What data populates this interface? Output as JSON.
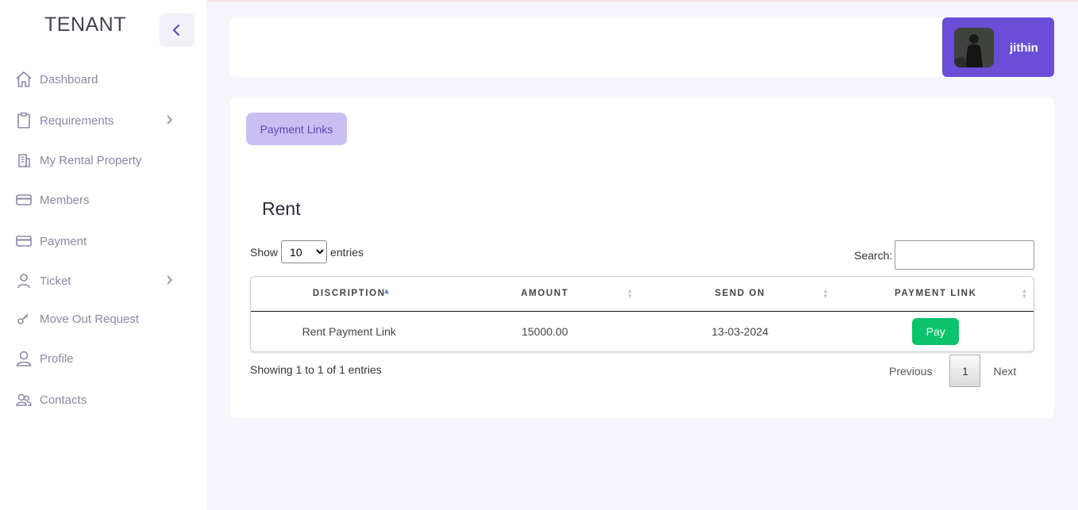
{
  "sidebar": {
    "brand": "TENANT",
    "items": [
      {
        "label": "Dashboard",
        "icon": "home-icon"
      },
      {
        "label": "Requirements",
        "icon": "clipboard-icon",
        "has_submenu": true
      },
      {
        "label": "My Rental Property",
        "icon": "building-icon"
      },
      {
        "label": "Members",
        "icon": "card-icon"
      },
      {
        "label": "Payment",
        "icon": "card-icon"
      },
      {
        "label": "Ticket",
        "icon": "person-icon",
        "has_submenu": true
      },
      {
        "label": "Move Out Request",
        "icon": "key-icon"
      },
      {
        "label": "Profile",
        "icon": "user-icon"
      },
      {
        "label": "Contacts",
        "icon": "users-icon"
      }
    ]
  },
  "header": {
    "user_name": "jithin"
  },
  "main": {
    "tab_label": "Payment Links",
    "section_title": "Rent",
    "show_label": "Show",
    "entries_label": "entries",
    "page_size": "10",
    "page_size_options": [
      "10"
    ],
    "search_label": "Search:",
    "search_value": "",
    "columns": [
      "DISCRIPTION",
      "AMOUNT",
      "SEND ON",
      "PAYMENT LINK"
    ],
    "rows": [
      {
        "description": "Rent Payment Link",
        "amount": "15000.00",
        "send_on": "13-03-2024",
        "action": "Pay"
      }
    ],
    "info": "Showing 1 to 1 of 1 entries",
    "pagination": {
      "previous": "Previous",
      "current": "1",
      "next": "Next"
    }
  },
  "colors": {
    "accent": "#6a4ed6",
    "tab_bg": "#cbbef3",
    "pay_button": "#0ac36a",
    "sidebar_text": "#8a87a6"
  }
}
